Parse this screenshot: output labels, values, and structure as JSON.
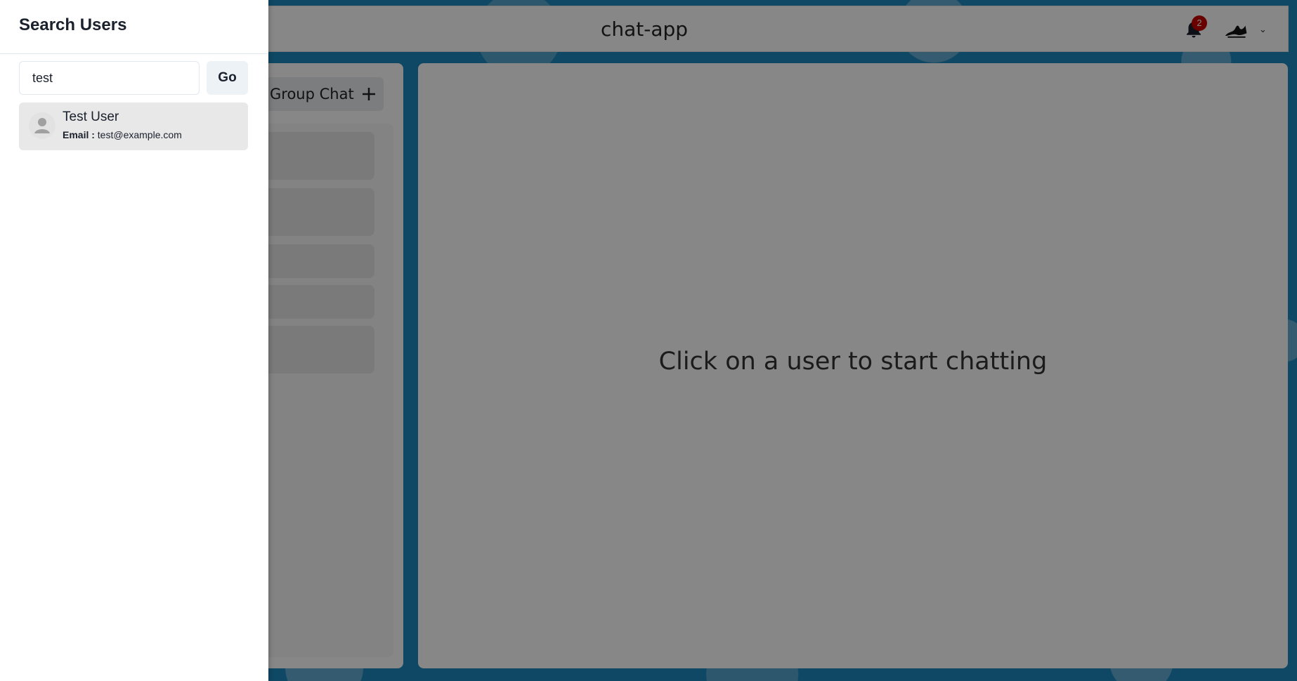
{
  "header": {
    "title": "chat-app",
    "notification_count": "2"
  },
  "sidebar": {
    "group_chat_label": "Group Chat"
  },
  "chat": {
    "hint": "Click on a user to start chatting"
  },
  "drawer": {
    "title": "Search Users",
    "search_value": "test",
    "go_label": "Go",
    "results": [
      {
        "name": "Test User",
        "email_label": "Email :",
        "email": "test@example.com"
      }
    ]
  },
  "colors": {
    "background": "#1e88bd",
    "badge": "#c40000",
    "overlay": "rgba(0,0,0,0.47)"
  },
  "icons": [
    "bell-icon",
    "plus-icon",
    "chevron-down-icon",
    "user-avatar-icon"
  ]
}
